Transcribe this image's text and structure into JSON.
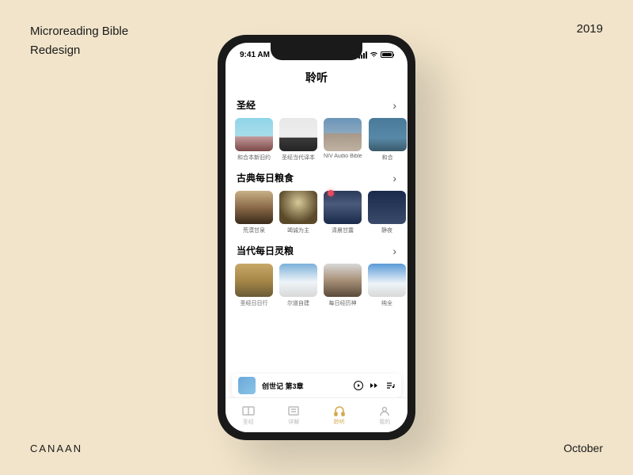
{
  "canvas": {
    "title_line1": "Microreading Bible",
    "title_line2": "Redesign",
    "year": "2019",
    "author": "CANAAN",
    "month": "October"
  },
  "statusbar": {
    "time": "9:41 AM"
  },
  "page_title": "聆听",
  "sections": [
    {
      "title": "圣经",
      "items": [
        {
          "label": "和合本新旧约"
        },
        {
          "label": "圣经当代译本"
        },
        {
          "label": "NIV Audio Bible"
        },
        {
          "label": "和合"
        }
      ]
    },
    {
      "title": "古典每日粮食",
      "items": [
        {
          "label": "荒漠甘泉"
        },
        {
          "label": "竭诚为主"
        },
        {
          "label": "清晨甘露"
        },
        {
          "label": "静夜"
        }
      ]
    },
    {
      "title": "当代每日灵粮",
      "items": [
        {
          "label": "圣经日日行"
        },
        {
          "label": "尔道自建"
        },
        {
          "label": "每日经历神"
        },
        {
          "label": "纯全"
        }
      ]
    }
  ],
  "player": {
    "title": "创世记 第3章"
  },
  "tabs": [
    {
      "label": "圣经"
    },
    {
      "label": "详解"
    },
    {
      "label": "聆听"
    },
    {
      "label": "我的"
    }
  ]
}
